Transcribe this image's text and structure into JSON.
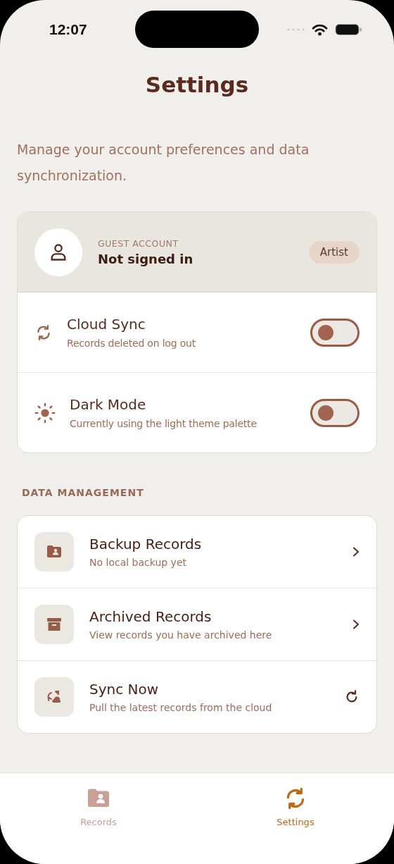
{
  "status_bar": {
    "time": "12:07"
  },
  "title": "Settings",
  "description": "Manage your account preferences and data synchronization.",
  "account": {
    "label": "GUEST ACCOUNT",
    "name": "Not signed in",
    "badge": "Artist"
  },
  "toggles": [
    {
      "title": "Cloud Sync",
      "subtitle": "Records deleted on log out",
      "on": false
    },
    {
      "title": "Dark Mode",
      "subtitle": "Currently using the light theme palette",
      "on": false
    }
  ],
  "data_management": {
    "heading": "DATA MANAGEMENT",
    "items": [
      {
        "title": "Backup Records",
        "subtitle": "No local backup yet",
        "kind": "link"
      },
      {
        "title": "Archived Records",
        "subtitle": "View records you have archived here",
        "kind": "link"
      },
      {
        "title": "Sync Now",
        "subtitle": "Pull the latest records from the cloud",
        "kind": "action"
      }
    ]
  },
  "tabs": [
    {
      "label": "Records",
      "selected": false
    },
    {
      "label": "Settings",
      "selected": true
    }
  ]
}
